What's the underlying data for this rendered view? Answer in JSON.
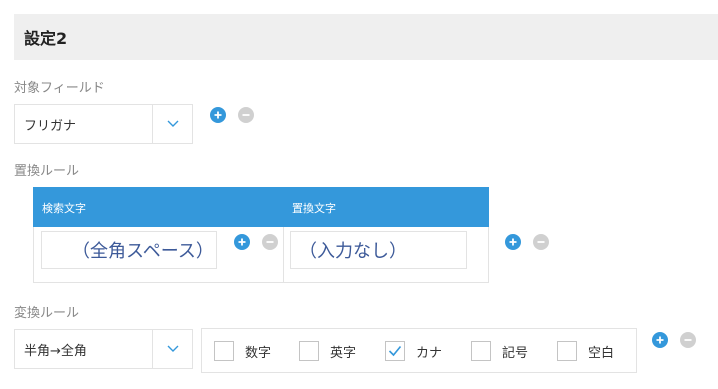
{
  "header": {
    "title": "設定2"
  },
  "target_field": {
    "label": "対象フィールド",
    "selected": "フリガナ",
    "add_icon": "plus-icon",
    "remove_icon": "minus-icon"
  },
  "replace_rules": {
    "label": "置換ルール",
    "columns": [
      "検索文字",
      "置換文字"
    ],
    "rows": [
      {
        "search": "（全角スペース）",
        "replace": "（入力なし）"
      }
    ]
  },
  "convert_rules": {
    "label": "変換ルール",
    "selected": "半角→全角",
    "options": [
      {
        "label": "数字",
        "checked": false
      },
      {
        "label": "英字",
        "checked": false
      },
      {
        "label": "カナ",
        "checked": true
      },
      {
        "label": "記号",
        "checked": false
      },
      {
        "label": "空白",
        "checked": false
      }
    ]
  },
  "colors": {
    "accent": "#3498db",
    "header_bg": "#efefef",
    "remove_button": "#d0d0d0",
    "input_text": "#3d5a99"
  }
}
